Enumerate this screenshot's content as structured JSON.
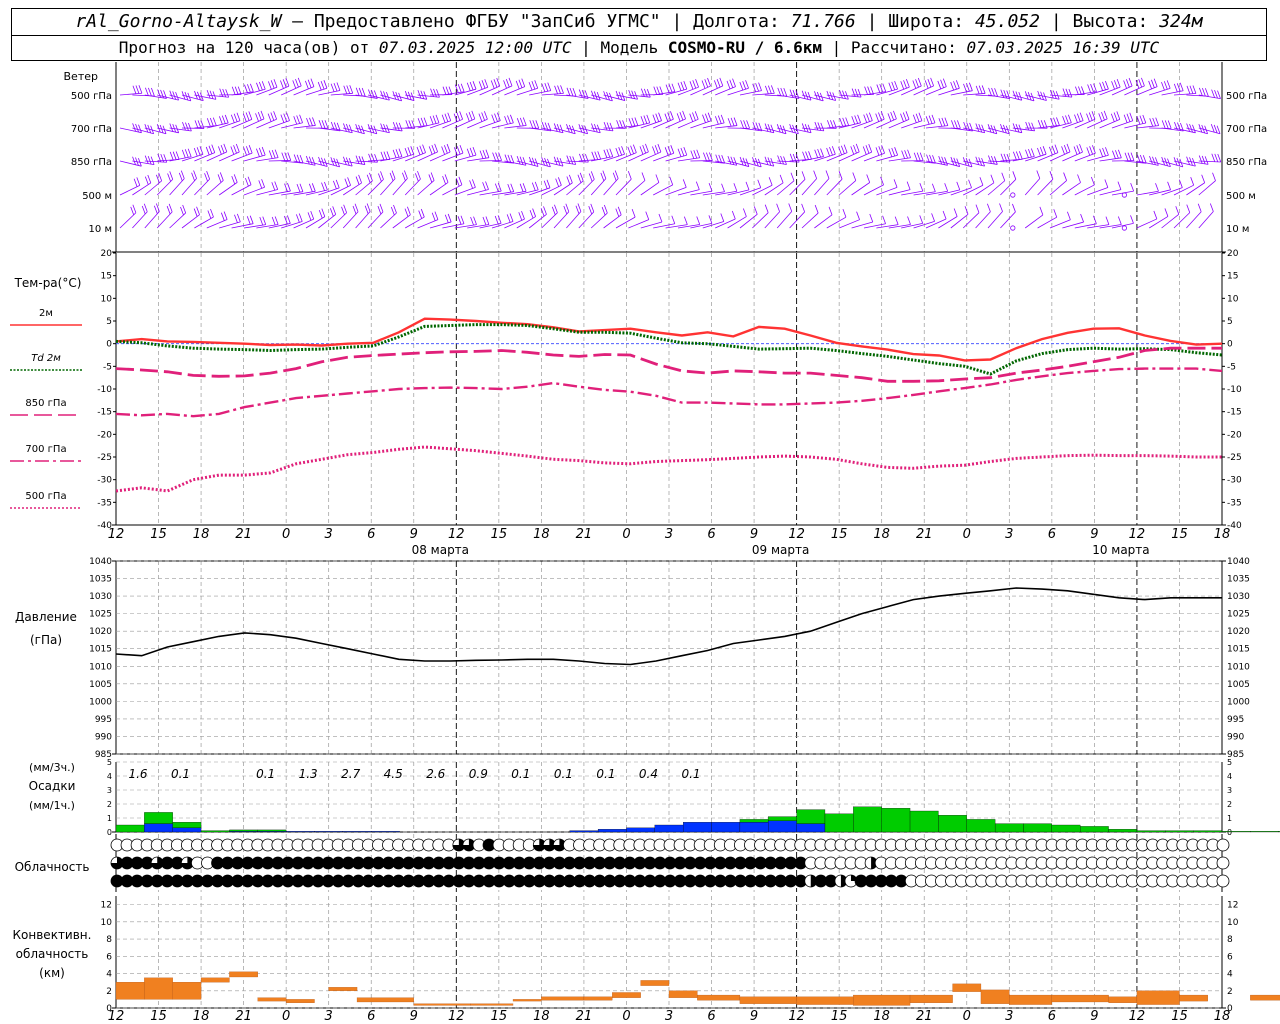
{
  "header": {
    "station": "rAl_Gorno-Altaysk_W",
    "provider": "– Предоставлено ФГБУ \"ЗапСиб УГМС\"",
    "lon_label": "Долгота:",
    "lon": "71.766",
    "lat_label": "Широта:",
    "lat": "45.052",
    "alt_label": "Высота:",
    "alt": "324м",
    "forecast_label": "Прогноз на 120 часа(ов) от",
    "forecast_from": "07.03.2025 12:00 UTC",
    "model_label": "Модель",
    "model": "COSMO-RU / 6.6км",
    "calc_label": "Рассчитано:",
    "calc": "07.03.2025 16:39 UTC"
  },
  "colors": {
    "wind": "#8b00ff",
    "t2m": "#ff3333",
    "td2m": "#006600",
    "t850": "#e0207a",
    "t700": "#e0207a",
    "t500": "#e0207a",
    "pressure": "#000000",
    "precip_liquid": "#00cc00",
    "precip_solid": "#0033ff",
    "convective": "#f08020",
    "zero_line": "#3344ff"
  },
  "chart_data": {
    "type": "meteogram",
    "time_axis": {
      "ticks": [
        "12",
        "15",
        "18",
        "21",
        "0",
        "3",
        "6",
        "9",
        "12",
        "15",
        "18",
        "21",
        "0",
        "3",
        "6",
        "9",
        "12",
        "15",
        "18",
        "21",
        "0",
        "3",
        "6",
        "9",
        "12",
        "15",
        "18"
      ],
      "date_labels": [
        {
          "label": "08 марта",
          "tick_index": 8
        },
        {
          "label": "09 марта",
          "tick_index": 16
        },
        {
          "label": "10 марта",
          "tick_index": 24
        }
      ]
    },
    "wind": {
      "title": "Ветер",
      "levels": [
        "500 гПа",
        "700 гПа",
        "850 гПа",
        "500 м",
        "10 м"
      ]
    },
    "temperature": {
      "title": "Тем-ра(°C)",
      "ylim": [
        -40,
        20
      ],
      "yticks": [
        20,
        15,
        10,
        5,
        0,
        -5,
        -10,
        -15,
        -20,
        -25,
        -30,
        -35,
        -40
      ],
      "series": [
        {
          "name": "2м",
          "style": "solid",
          "values": [
            0.5,
            1.0,
            0.5,
            0.4,
            0.2,
            0.0,
            -0.3,
            -0.2,
            -0.4,
            0.0,
            0.2,
            2.5,
            5.5,
            5.3,
            5.0,
            4.6,
            4.3,
            3.6,
            2.7,
            3.0,
            3.3,
            2.5,
            1.8,
            2.5,
            1.6,
            3.7,
            3.3,
            1.8,
            0.2,
            -0.6,
            -1.3,
            -2.3,
            -2.6,
            -3.7,
            -3.5,
            -1.0,
            1.0,
            2.4,
            3.3,
            3.4,
            1.8,
            0.6,
            -0.2,
            0.0
          ]
        },
        {
          "name": "Td 2м",
          "style": "dotted",
          "values": [
            0.5,
            0.2,
            -0.5,
            -1.0,
            -1.2,
            -1.3,
            -1.5,
            -1.3,
            -1.2,
            -0.8,
            -0.5,
            1.5,
            3.8,
            4.0,
            4.2,
            4.2,
            4.0,
            3.3,
            2.5,
            2.5,
            2.3,
            1.2,
            0.2,
            0.0,
            -0.6,
            -1.2,
            -1.1,
            -1.0,
            -1.5,
            -2.2,
            -2.8,
            -3.6,
            -4.4,
            -5.0,
            -6.7,
            -3.8,
            -2.2,
            -1.3,
            -1.0,
            -1.2,
            -1.1,
            -1.3,
            -2.0,
            -2.5
          ]
        },
        {
          "name": "850 гПа",
          "style": "long-dash",
          "values": [
            -5.5,
            -5.8,
            -6.2,
            -7.0,
            -7.2,
            -7.1,
            -6.5,
            -5.5,
            -4.0,
            -3.0,
            -2.6,
            -2.3,
            -2.0,
            -1.8,
            -1.7,
            -1.5,
            -1.9,
            -2.5,
            -2.8,
            -2.4,
            -2.5,
            -4.5,
            -6.0,
            -6.5,
            -6.0,
            -6.2,
            -6.5,
            -6.5,
            -7.0,
            -7.5,
            -8.3,
            -8.3,
            -8.2,
            -7.8,
            -7.5,
            -6.5,
            -5.8,
            -5.0,
            -4.0,
            -3.0,
            -1.5,
            -1.0,
            -1.0,
            -1.0
          ]
        },
        {
          "name": "700 гПа",
          "style": "dash-dot",
          "values": [
            -15.5,
            -15.8,
            -15.5,
            -16.0,
            -15.5,
            -14.0,
            -13.0,
            -12.0,
            -11.5,
            -11.0,
            -10.5,
            -10.0,
            -9.8,
            -9.7,
            -9.8,
            -10.0,
            -9.5,
            -8.7,
            -9.5,
            -10.2,
            -10.6,
            -11.5,
            -13.0,
            -13.0,
            -13.2,
            -13.4,
            -13.4,
            -13.2,
            -13.0,
            -12.6,
            -12.0,
            -11.3,
            -10.5,
            -9.8,
            -9.0,
            -8.0,
            -7.2,
            -6.5,
            -6.0,
            -5.6,
            -5.5,
            -5.5,
            -5.5,
            -6.0
          ]
        },
        {
          "name": "500 гПа",
          "style": "fine-dot",
          "values": [
            -32.5,
            -31.8,
            -32.5,
            -30.0,
            -29.0,
            -29.0,
            -28.5,
            -26.5,
            -25.5,
            -24.5,
            -24.0,
            -23.3,
            -22.8,
            -23.2,
            -23.6,
            -24.2,
            -24.8,
            -25.5,
            -25.8,
            -26.3,
            -26.5,
            -26.0,
            -25.8,
            -25.6,
            -25.3,
            -25.0,
            -24.8,
            -25.0,
            -25.5,
            -26.5,
            -27.3,
            -27.5,
            -27.0,
            -26.8,
            -26.0,
            -25.3,
            -25.0,
            -24.7,
            -24.6,
            -24.7,
            -24.7,
            -24.8,
            -25.0,
            -25.0
          ]
        }
      ]
    },
    "pressure": {
      "title": "Давление",
      "unit": "(гПа)",
      "ylim": [
        985,
        1040
      ],
      "yticks": [
        1040,
        1035,
        1030,
        1025,
        1020,
        1015,
        1010,
        1005,
        1000,
        995,
        990,
        985
      ],
      "values": [
        1013.5,
        1013.0,
        1015.5,
        1017.0,
        1018.5,
        1019.5,
        1019.0,
        1018.0,
        1016.5,
        1015.0,
        1013.5,
        1012.0,
        1011.5,
        1011.5,
        1011.7,
        1011.8,
        1012.0,
        1012.0,
        1011.5,
        1010.8,
        1010.5,
        1011.5,
        1013.0,
        1014.5,
        1016.5,
        1017.5,
        1018.5,
        1020.0,
        1022.5,
        1025.0,
        1027.0,
        1029.0,
        1030.0,
        1030.8,
        1031.5,
        1032.3,
        1032.0,
        1031.5,
        1030.5,
        1029.5,
        1029.0,
        1029.5,
        1029.5,
        1029.5
      ]
    },
    "precipitation": {
      "title": "Осадки",
      "unit_3h": "(мм/3ч.)",
      "unit_1h": "(мм/1ч.)",
      "ylim": [
        0,
        5
      ],
      "yticks": [
        5,
        4,
        3,
        2,
        1,
        0
      ],
      "totals_3h": [
        {
          "tick_index": 0,
          "value": "1.6"
        },
        {
          "tick_index": 1,
          "value": "0.1"
        },
        {
          "tick_index": 3,
          "value": "0.1"
        },
        {
          "tick_index": 4,
          "value": "1.3"
        },
        {
          "tick_index": 5,
          "value": "2.7"
        },
        {
          "tick_index": 6,
          "value": "4.5"
        },
        {
          "tick_index": 7,
          "value": "2.6"
        },
        {
          "tick_index": 8,
          "value": "0.9"
        },
        {
          "tick_index": 9,
          "value": "0.1"
        },
        {
          "tick_index": 10,
          "value": "0.1"
        },
        {
          "tick_index": 11,
          "value": "0.1"
        },
        {
          "tick_index": 12,
          "value": "0.4"
        },
        {
          "tick_index": 13,
          "value": "0.1"
        }
      ],
      "liquid_hourly": [
        0.5,
        0.8,
        0.4,
        0.1,
        0.1,
        0.1,
        0.0,
        0.0,
        0.0,
        0.0,
        0.0,
        0.0,
        0.0,
        0.0,
        0.0,
        0.0,
        0.0,
        0.0,
        0.0,
        0.0,
        0.0,
        0.0,
        0.2,
        0.3,
        1.0,
        1.3,
        1.8,
        1.7,
        1.5,
        1.2,
        0.9,
        0.6,
        0.6,
        0.5,
        0.4,
        0.2,
        0.1,
        0.1,
        0.1,
        0.05,
        0.05,
        0.05,
        0.05,
        0.05,
        0.05,
        0.1,
        0.1,
        0.1,
        0.05,
        0.05,
        0.05,
        0.05,
        0.05,
        0.05,
        0.2,
        0.3,
        0.3,
        0.2,
        0.1,
        0.1,
        0.05,
        0.05
      ],
      "solid_hourly": [
        0.0,
        0.6,
        0.3,
        0.0,
        0.05,
        0.05,
        0.05,
        0.05,
        0.05,
        0.05,
        0.0,
        0.0,
        0.0,
        0.0,
        0.0,
        0.0,
        0.1,
        0.2,
        0.3,
        0.5,
        0.7,
        0.7,
        0.7,
        0.8,
        0.6,
        0.0,
        0.0,
        0.0,
        0.0,
        0.0,
        0.0,
        0.0,
        0.0,
        0.0,
        0.0,
        0.0,
        0.0,
        0.0,
        0.0,
        0.0,
        0.0,
        0.0,
        0.0,
        0.0,
        0.0,
        0.0,
        0.0,
        0.0,
        0.0,
        0.0,
        0.0,
        0.0,
        0.0,
        0.0,
        0.0,
        0.0,
        0.0,
        0.0,
        0.0,
        0.0,
        0.0,
        0.0
      ]
    },
    "clouds": {
      "title": "Облачность",
      "rows": [
        "0000000000000000000000000000000000330400003330000000000000000000000000000000000000000000000000000000000000000000",
        "3444344300444444444444444444444444444444444444444444444444444444444440000002000000000000000000000000000000000000",
        "4444444444444444444444444444444444444444444444444444444444444444444442442144444000000000000000000000000000000000"
      ]
    },
    "convective": {
      "title": "Конвективн.",
      "title2": "облачность",
      "unit": "(км)",
      "ylim": [
        0,
        13
      ],
      "yticks": [
        12,
        10,
        8,
        6,
        4,
        2,
        0
      ],
      "segments": [
        [
          0,
          2,
          3.0,
          1.0
        ],
        [
          2,
          4,
          3.5,
          1.0
        ],
        [
          4,
          6,
          3.0,
          1.0
        ],
        [
          6,
          8,
          3.5,
          3.0
        ],
        [
          8,
          10,
          4.2,
          3.6
        ],
        [
          10,
          12,
          1.2,
          0.8
        ],
        [
          12,
          14,
          1.0,
          0.6
        ],
        [
          15,
          17,
          2.4,
          2.0
        ],
        [
          17,
          21,
          1.2,
          0.7
        ],
        [
          21,
          25,
          0.5,
          0.3
        ],
        [
          25,
          28,
          0.5,
          0.3
        ],
        [
          28,
          30,
          1.0,
          0.8
        ],
        [
          30,
          33,
          1.3,
          0.9
        ],
        [
          33,
          35,
          1.3,
          0.9
        ],
        [
          35,
          37,
          1.8,
          1.2
        ],
        [
          37,
          39,
          3.2,
          2.6
        ],
        [
          39,
          41,
          2.0,
          1.2
        ],
        [
          41,
          44,
          1.5,
          0.9
        ],
        [
          44,
          48,
          1.3,
          0.5
        ],
        [
          48,
          52,
          1.3,
          0.4
        ],
        [
          52,
          56,
          1.5,
          0.3
        ],
        [
          56,
          59,
          1.5,
          0.6
        ],
        [
          59,
          61,
          2.8,
          1.9
        ],
        [
          61,
          63,
          2.1,
          0.5
        ],
        [
          63,
          66,
          1.5,
          0.4
        ],
        [
          66,
          70,
          1.5,
          0.7
        ],
        [
          70,
          72,
          1.3,
          0.6
        ],
        [
          72,
          75,
          2.0,
          0.4
        ],
        [
          75,
          77,
          1.5,
          0.8
        ],
        [
          80,
          83,
          1.5,
          0.9
        ],
        [
          83,
          86,
          2.0,
          1.2
        ],
        [
          86,
          90,
          2.6,
          1.2
        ],
        [
          90,
          93,
          1.3,
          0.9
        ],
        [
          93,
          95,
          0.5,
          0.3
        ],
        [
          126,
          132,
          1.3,
          1.0
        ]
      ]
    }
  }
}
